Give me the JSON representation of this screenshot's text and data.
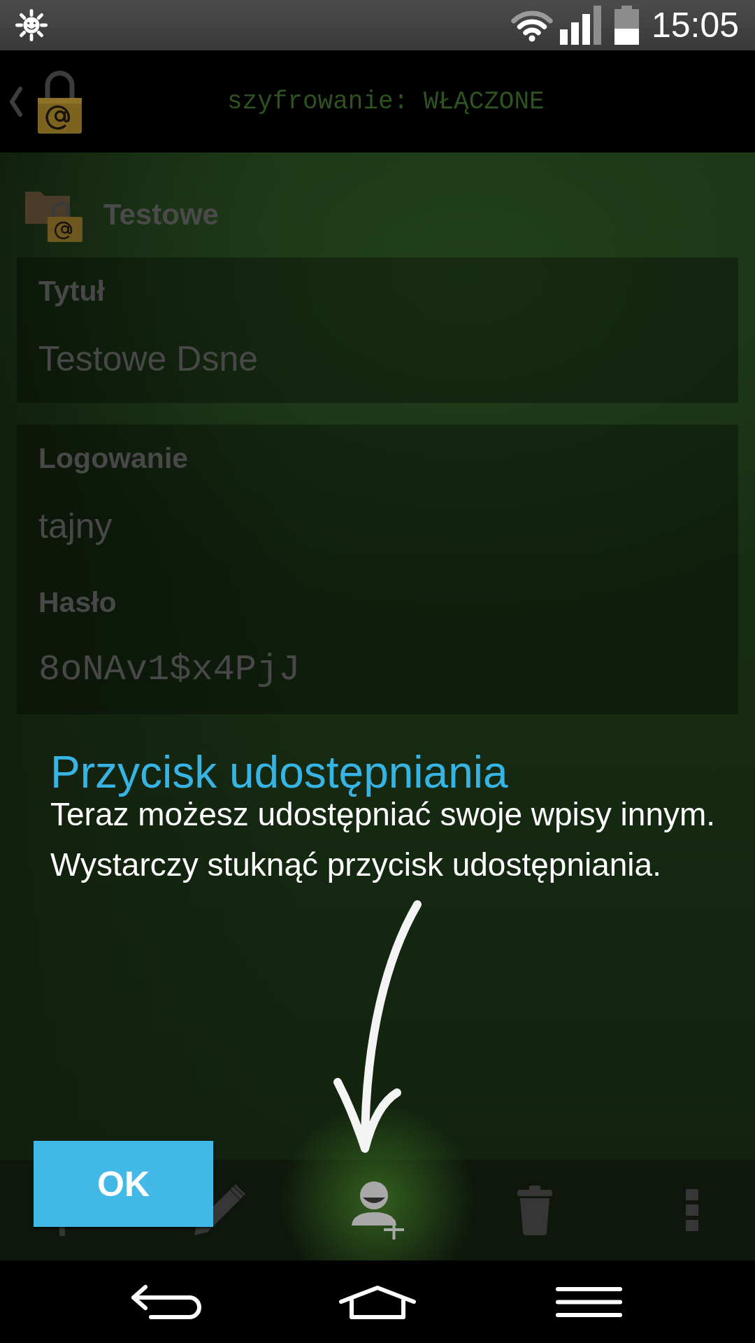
{
  "status_bar": {
    "time": "15:05"
  },
  "action_bar": {
    "title": "szyfrowanie: WŁĄCZONE"
  },
  "folder": {
    "name": "Testowe"
  },
  "cards": [
    {
      "fields": [
        {
          "kind": "text",
          "label": "Tytuł",
          "value": "Testowe Dsne"
        }
      ]
    },
    {
      "fields": [
        {
          "kind": "text",
          "label": "Logowanie",
          "value": "tajny"
        },
        {
          "kind": "password",
          "label": "Hasło",
          "value": "8oNAv1$x4PjJ"
        }
      ]
    }
  ],
  "showcase": {
    "title": "Przycisk udostępniania",
    "lines": [
      "Teraz możesz udostępniać swoje wpisy innym.",
      "Wystarczy stuknąć przycisk udostępniania."
    ],
    "button": "OK"
  },
  "toolbar": [
    {
      "kind": "covered",
      "highlighted": false
    },
    {
      "kind": "edit",
      "highlighted": false
    },
    {
      "kind": "share",
      "highlighted": true
    },
    {
      "kind": "delete",
      "highlighted": false
    },
    {
      "kind": "overflow",
      "highlighted": false
    }
  ]
}
